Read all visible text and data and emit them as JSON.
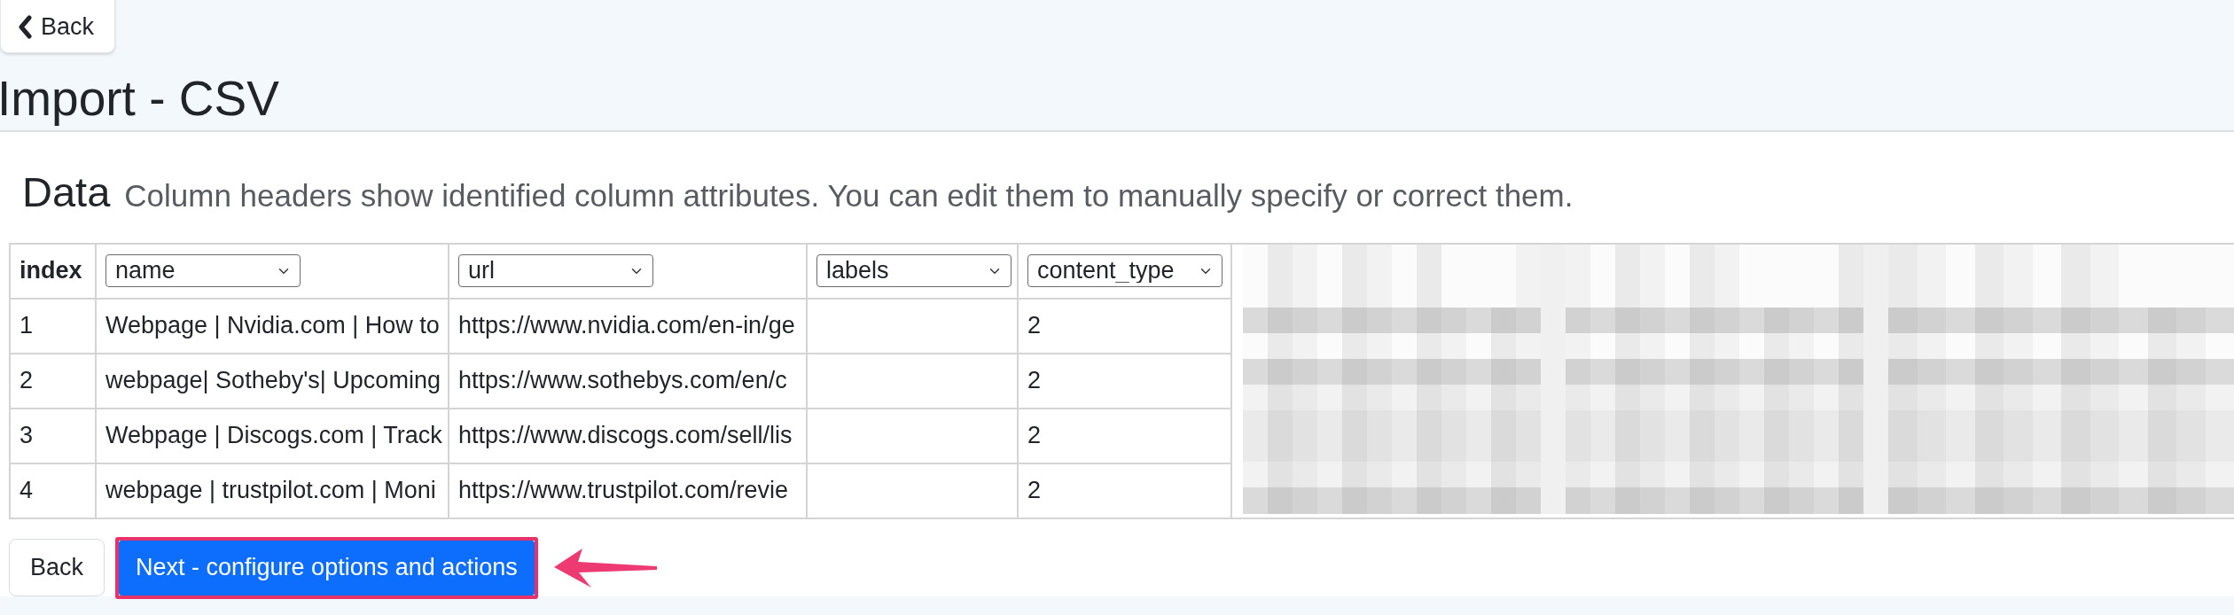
{
  "back_link": {
    "label": "Back"
  },
  "title": "Import - CSV",
  "section": {
    "heading": "Data",
    "description": "Column headers show identified column attributes. You can edit them to manually specify or correct them."
  },
  "table": {
    "columns": [
      {
        "kind": "label",
        "label": "index"
      },
      {
        "kind": "select",
        "value": "name"
      },
      {
        "kind": "select",
        "value": "url"
      },
      {
        "kind": "select",
        "value": "labels"
      },
      {
        "kind": "select",
        "value": "content_type"
      }
    ],
    "rows": [
      {
        "index": "1",
        "name": "Webpage | Nvidia.com | How to",
        "url": "https://www.nvidia.com/en-in/ge",
        "content_type": "2"
      },
      {
        "index": "2",
        "name": "webpage| Sotheby's| Upcoming",
        "url": "https://www.sothebys.com/en/c",
        "content_type": "2"
      },
      {
        "index": "3",
        "name": "Webpage | Discogs.com | Track",
        "url": "https://www.discogs.com/sell/lis",
        "content_type": "2"
      },
      {
        "index": "4",
        "name": "webpage | trustpilot.com | Moni",
        "url": "https://www.trustpilot.com/revie",
        "content_type": "2"
      }
    ],
    "redacted": true
  },
  "actions": [
    {
      "kind": "secondary",
      "label": "Back",
      "highlighted": false
    },
    {
      "kind": "primary",
      "label": "Next - configure options and actions",
      "highlighted": true
    }
  ]
}
